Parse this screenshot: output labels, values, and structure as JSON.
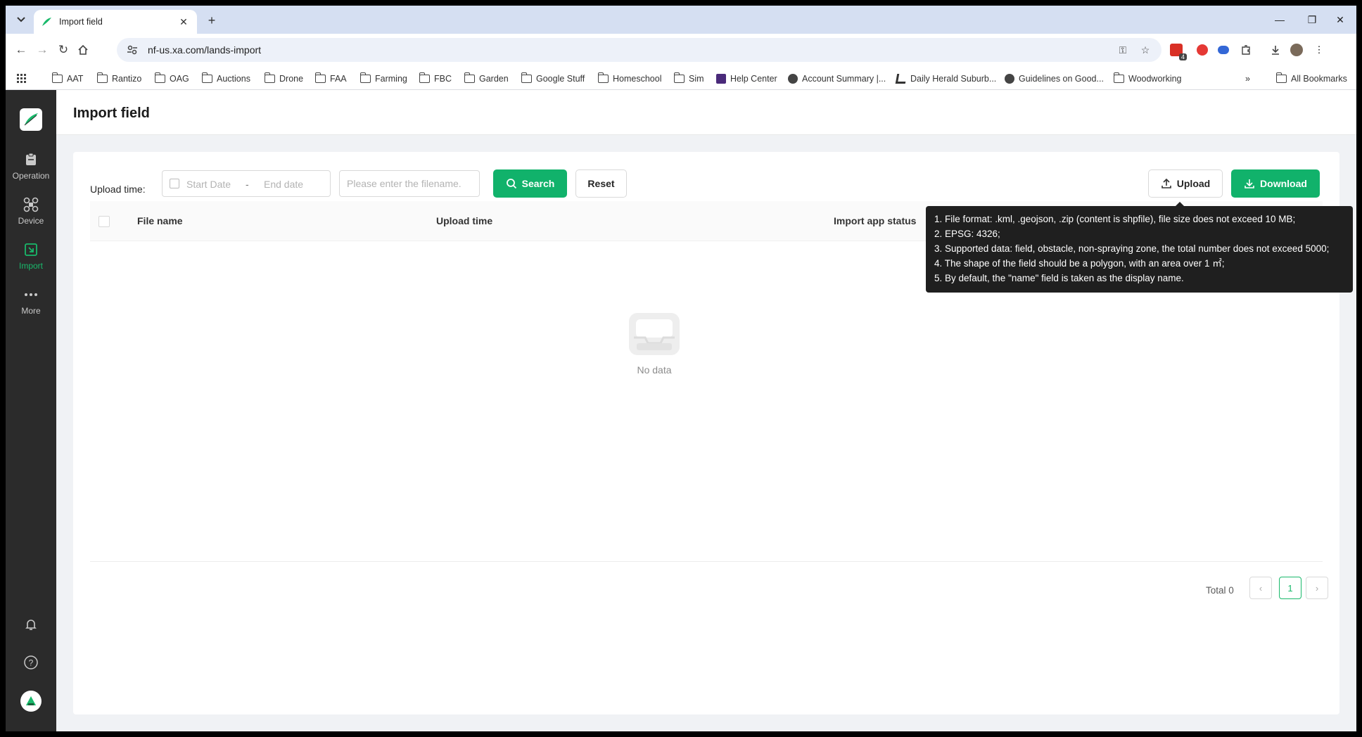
{
  "browser": {
    "tab_title": "Import field",
    "url": "nf-us.xa.com/lands-import",
    "extension_badge": "4",
    "bookmarks": [
      {
        "label": "AAT",
        "icon": "folder-icon"
      },
      {
        "label": "Rantizo",
        "icon": "folder-icon"
      },
      {
        "label": "OAG",
        "icon": "folder-icon"
      },
      {
        "label": "Auctions",
        "icon": "folder-icon"
      },
      {
        "label": "Drone",
        "icon": "folder-icon"
      },
      {
        "label": "FAA",
        "icon": "folder-icon"
      },
      {
        "label": "Farming",
        "icon": "folder-icon"
      },
      {
        "label": "FBC",
        "icon": "folder-icon"
      },
      {
        "label": "Garden",
        "icon": "folder-icon"
      },
      {
        "label": "Google Stuff",
        "icon": "folder-icon"
      },
      {
        "label": "Homeschool",
        "icon": "folder-icon"
      },
      {
        "label": "Sim",
        "icon": "folder-icon"
      },
      {
        "label": "Help Center",
        "icon": "site-icon"
      },
      {
        "label": "Account Summary |...",
        "icon": "globe-icon"
      },
      {
        "label": "Daily Herald Suburb...",
        "icon": "site-icon"
      },
      {
        "label": "Guidelines on Good...",
        "icon": "globe-icon"
      },
      {
        "label": "Woodworking",
        "icon": "folder-icon"
      }
    ],
    "all_bookmarks": "All Bookmarks"
  },
  "sidebar": {
    "items": [
      {
        "label": "Operation",
        "icon": "clipboard-icon"
      },
      {
        "label": "Device",
        "icon": "drone-icon"
      },
      {
        "label": "Import",
        "icon": "import-icon"
      },
      {
        "label": "More",
        "icon": "more-icon"
      }
    ]
  },
  "page": {
    "title": "Import field"
  },
  "filters": {
    "upload_time_label": "Upload time:",
    "start_placeholder": "Start Date",
    "separator": "-",
    "end_placeholder": "End date",
    "filename_placeholder": "Please enter the filename.",
    "search_label": "Search",
    "reset_label": "Reset",
    "upload_label": "Upload",
    "download_label": "Download"
  },
  "table": {
    "columns": [
      "File name",
      "Upload time",
      "Import app status"
    ],
    "empty_text": "No data"
  },
  "pagination": {
    "total_text": "Total 0",
    "current_page": "1"
  },
  "tooltip": {
    "lines": [
      "1. File format: .kml, .geojson, .zip (content is shpfile), file size does not exceed 10 MB;",
      "2. EPSG: 4326;",
      "3. Supported data: field, obstacle, non-spraying zone, the total number does not exceed 5000;",
      "4. The shape of the field should be a polygon, with an area over 1 ㎡;",
      "5. By default, the \"name\" field is taken as the display name."
    ]
  },
  "colors": {
    "accent": "#11b26b",
    "sidebar_bg": "#2b2b2b",
    "tooltip_bg": "#1f1f1f"
  }
}
